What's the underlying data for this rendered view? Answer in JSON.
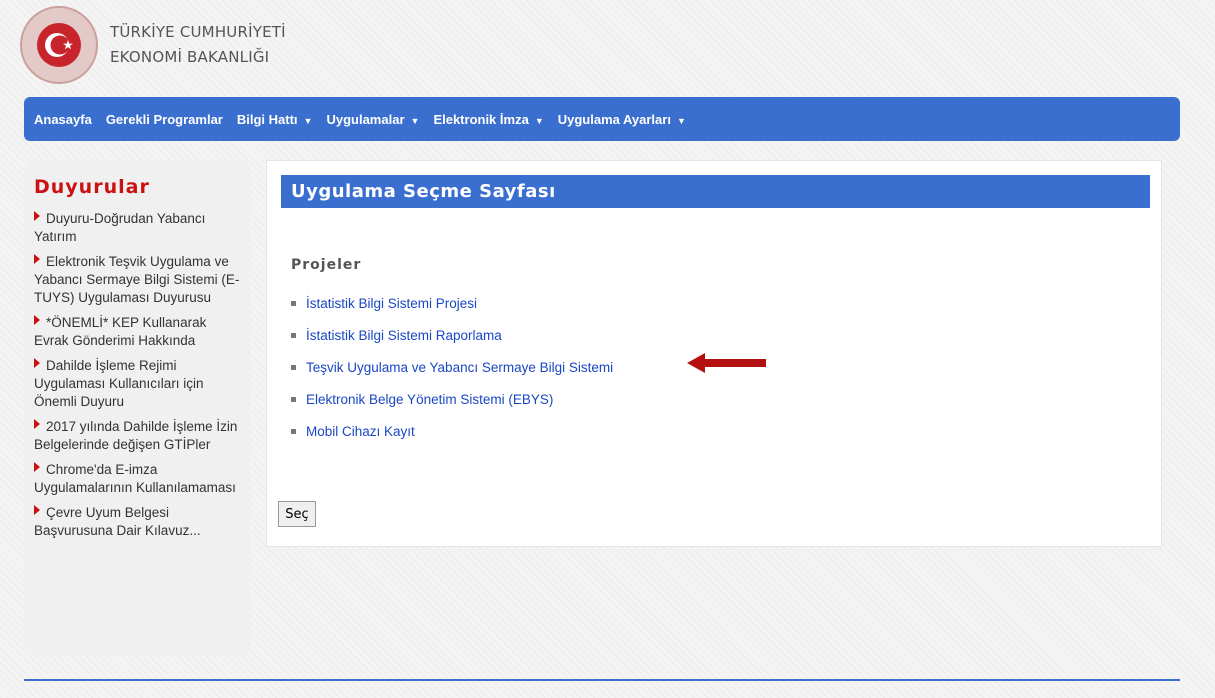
{
  "header": {
    "org_line1": "TÜRKİYE CUMHURİYETİ",
    "org_line2": "EKONOMİ BAKANLIĞI",
    "logo_icon": "crescent-star-seal-icon"
  },
  "nav": {
    "items": [
      {
        "label": "Anasayfa",
        "dropdown": false
      },
      {
        "label": "Gerekli Programlar",
        "dropdown": false
      },
      {
        "label": "Bilgi Hattı",
        "dropdown": true
      },
      {
        "label": "Uygulamalar",
        "dropdown": true
      },
      {
        "label": "Elektronik İmza",
        "dropdown": true
      },
      {
        "label": "Uygulama Ayarları",
        "dropdown": true
      }
    ],
    "caret": "▼"
  },
  "sidebar": {
    "title": "Duyurular",
    "items": [
      "Duyuru-Doğrudan Yabancı Yatırım",
      "Elektronik Teşvik Uygulama ve Yabancı Sermaye Bilgi Sistemi (E-TUYS) Uygulaması Duyurusu",
      "*ÖNEMLİ* KEP Kullanarak Evrak Gönderimi Hakkında",
      "Dahilde İşleme Rejimi Uygulaması Kullanıcıları için Önemli Duyuru",
      "2017 yılında Dahilde İşleme İzin Belgelerinde değişen GTİPler",
      "Chrome'da E-imza Uygulamalarının Kullanılamaması",
      "Çevre Uyum Belgesi Başvurusuna Dair Kılavuz..."
    ]
  },
  "main": {
    "title": "Uygulama Seçme Sayfası",
    "section_label": "Projeler",
    "projects": [
      "İstatistik Bilgi Sistemi Projesi",
      "İstatistik Bilgi Sistemi Raporlama",
      "Teşvik Uygulama ve Yabancı Sermaye Bilgi Sistemi",
      "Elektronik Belge Yönetim Sistemi (EBYS)",
      "Mobil Cihazı Kayıt"
    ],
    "select_button": "Seç"
  },
  "colors": {
    "nav_bg": "#3a6fd0",
    "accent_red": "#cc1111",
    "link": "#1a47c4",
    "arrow": "#b51010"
  }
}
